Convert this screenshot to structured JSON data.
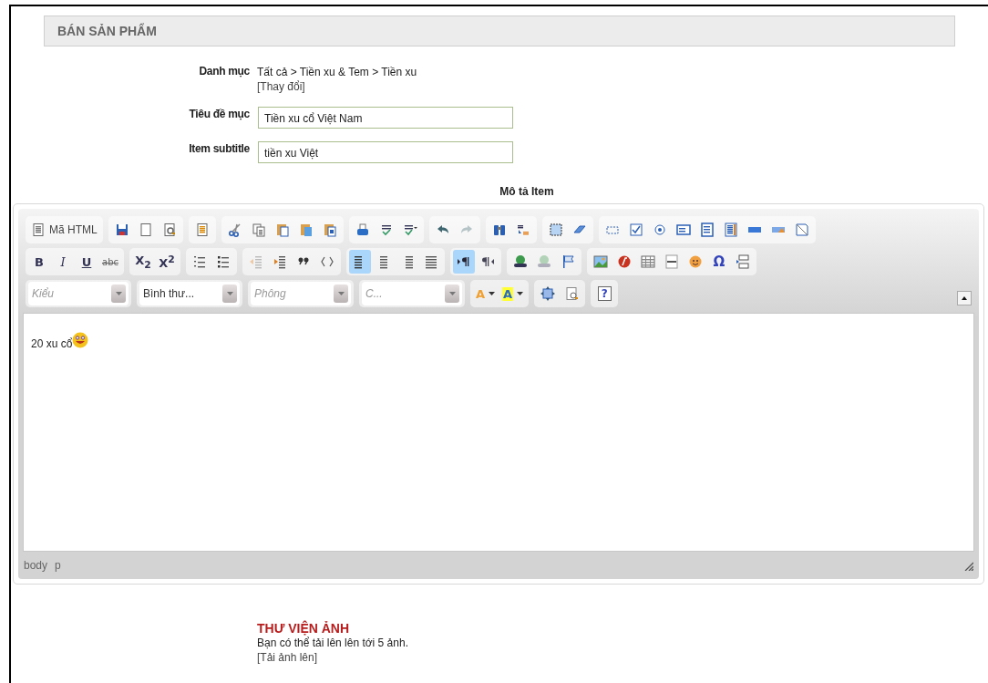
{
  "header": {
    "title": "BÁN SẢN PHẨM"
  },
  "form": {
    "category": {
      "label": "Danh mục",
      "path": "Tất cả > Tiền xu & Tem > Tiền xu",
      "change_link": "[Thay đổi]"
    },
    "fields": [
      {
        "label": "Tiêu đề mục",
        "value": "Tiền xu cổ Việt Nam"
      },
      {
        "label": "Item subtitle",
        "value": "tiền xu Việt"
      }
    ]
  },
  "editor": {
    "title": "Mô tả Item",
    "toolbar": [
      [
        [
          {
            "kind": "source",
            "label": "Mã HTML",
            "selected": false,
            "disabled": false
          }
        ],
        [
          {
            "kind": "icon",
            "selected": false,
            "disabled": false
          },
          {
            "kind": "icon",
            "selected": false,
            "disabled": false
          },
          {
            "kind": "icon",
            "selected": false,
            "disabled": false
          }
        ],
        [
          {
            "kind": "icon",
            "selected": false,
            "disabled": false
          }
        ],
        [
          {
            "kind": "icon",
            "selected": false,
            "disabled": false
          },
          {
            "kind": "icon",
            "selected": false,
            "disabled": false
          },
          {
            "kind": "icon",
            "selected": false,
            "disabled": false
          },
          {
            "kind": "icon",
            "selected": false,
            "disabled": false
          },
          {
            "kind": "icon",
            "selected": false,
            "disabled": false
          }
        ],
        [
          {
            "kind": "icon",
            "selected": false,
            "disabled": false
          },
          {
            "kind": "icon",
            "selected": false,
            "disabled": false
          },
          {
            "kind": "icon",
            "selected": false,
            "disabled": false
          }
        ],
        [
          {
            "kind": "icon",
            "selected": false,
            "disabled": false
          },
          {
            "kind": "icon",
            "selected": false,
            "disabled": true
          }
        ],
        [
          {
            "kind": "icon",
            "selected": false,
            "disabled": false
          },
          {
            "kind": "icon",
            "selected": false,
            "disabled": false
          }
        ],
        [
          {
            "kind": "icon",
            "selected": false,
            "disabled": false
          },
          {
            "kind": "icon",
            "selected": false,
            "disabled": false
          }
        ],
        [
          {
            "kind": "icon",
            "selected": false,
            "disabled": false
          },
          {
            "kind": "icon",
            "selected": false,
            "disabled": false
          },
          {
            "kind": "icon",
            "selected": false,
            "disabled": false
          },
          {
            "kind": "icon",
            "selected": false,
            "disabled": false
          },
          {
            "kind": "icon",
            "selected": false,
            "disabled": false
          },
          {
            "kind": "icon",
            "selected": false,
            "disabled": false
          },
          {
            "kind": "icon",
            "selected": false,
            "disabled": false
          },
          {
            "kind": "icon",
            "selected": false,
            "disabled": false
          },
          {
            "kind": "icon",
            "selected": false,
            "disabled": false
          }
        ]
      ],
      [
        [
          {
            "kind": "bold",
            "label": "B",
            "selected": false,
            "disabled": false
          },
          {
            "kind": "italic",
            "label": "I",
            "selected": false,
            "disabled": false
          },
          {
            "kind": "underline",
            "label": "U",
            "selected": false,
            "disabled": false
          },
          {
            "kind": "strike",
            "label": "abc",
            "selected": false,
            "disabled": false
          }
        ],
        [
          {
            "kind": "script",
            "label": "X$_{2}$",
            "selected": false,
            "disabled": false
          },
          {
            "kind": "script",
            "label": "X$^{2}$",
            "selected": false,
            "disabled": false
          }
        ],
        [
          {
            "kind": "icon",
            "selected": false,
            "disabled": false
          },
          {
            "kind": "icon",
            "selected": false,
            "disabled": false
          }
        ],
        [
          {
            "kind": "icon",
            "selected": false,
            "disabled": true
          },
          {
            "kind": "icon",
            "selected": false,
            "disabled": false
          },
          {
            "kind": "icon",
            "selected": false,
            "disabled": false
          },
          {
            "kind": "icon",
            "selected": false,
            "disabled": false
          }
        ],
        [
          {
            "kind": "icon",
            "selected": true,
            "disabled": false
          },
          {
            "kind": "icon",
            "selected": false,
            "disabled": false
          },
          {
            "kind": "icon",
            "selected": false,
            "disabled": false
          },
          {
            "kind": "icon",
            "selected": false,
            "disabled": false
          }
        ],
        [
          {
            "kind": "icon",
            "selected": true,
            "disabled": false
          },
          {
            "kind": "icon",
            "selected": false,
            "disabled": false
          }
        ],
        [
          {
            "kind": "icon",
            "selected": false,
            "disabled": false
          },
          {
            "kind": "icon",
            "selected": false,
            "disabled": true
          },
          {
            "kind": "icon",
            "selected": false,
            "disabled": false
          }
        ],
        [
          {
            "kind": "icon",
            "selected": false,
            "disabled": false
          },
          {
            "kind": "icon",
            "selected": false,
            "disabled": false
          },
          {
            "kind": "icon",
            "selected": false,
            "disabled": false
          },
          {
            "kind": "icon",
            "selected": false,
            "disabled": false
          },
          {
            "kind": "icon",
            "selected": false,
            "disabled": false
          },
          {
            "kind": "glyph",
            "label": "Ω",
            "selected": false,
            "disabled": false
          },
          {
            "kind": "icon",
            "selected": false,
            "disabled": false
          }
        ]
      ],
      [
        [
          {
            "kind": "combo",
            "placeholder": "Kiểu",
            "disabled": false
          }
        ],
        [
          {
            "kind": "combo",
            "value": "Bình thư...",
            "disabled": false
          }
        ],
        [
          {
            "kind": "combo",
            "placeholder": "Phông",
            "disabled": false
          }
        ],
        [
          {
            "kind": "combo",
            "placeholder": "C...",
            "disabled": false
          }
        ],
        [
          {
            "kind": "textcolor",
            "label": "A",
            "selected": false,
            "disabled": false
          },
          {
            "kind": "bgcolor",
            "label": "A",
            "selected": false,
            "disabled": false
          }
        ],
        [
          {
            "kind": "icon",
            "selected": false,
            "disabled": false
          },
          {
            "kind": "icon",
            "selected": false,
            "disabled": false
          }
        ],
        [
          {
            "kind": "help",
            "label": "?",
            "selected": false,
            "disabled": false
          }
        ]
      ]
    ],
    "content": "20 xu cổ",
    "path": [
      "body",
      "p"
    ]
  },
  "gallery": {
    "title": "THƯ VIỆN ẢNH",
    "note": "Bạn có thể tải lên lên tới 5 ảnh.",
    "upload_link": "[Tải ảnh lên]"
  }
}
